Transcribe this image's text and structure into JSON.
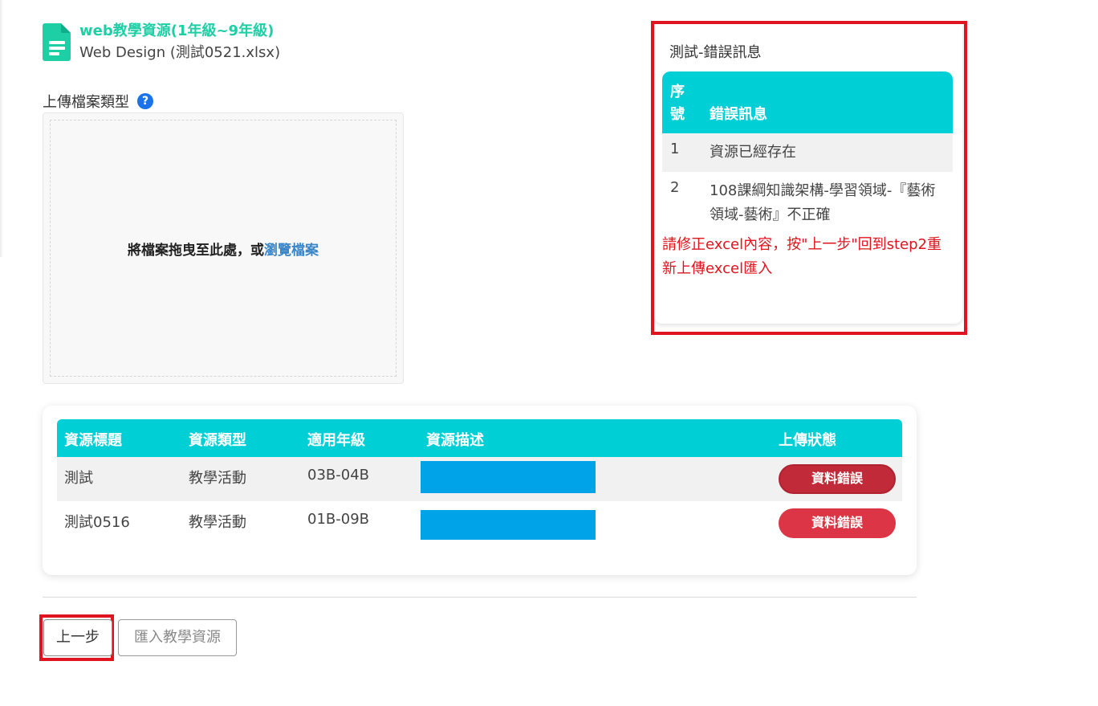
{
  "file": {
    "title": "web教學資源(1年級~9年級)",
    "subtitle": "Web Design (測試0521.xlsx)",
    "icon": "document-icon",
    "title_color": "#1ecfa6"
  },
  "upload": {
    "label": "上傳檔案類型",
    "help_icon": "question-circle-icon",
    "drop_text": "將檔案拖曳至此處，或",
    "browse_link": "瀏覽檔案"
  },
  "error_panel": {
    "title": "測試-錯誤訊息",
    "columns": [
      "序號",
      "錯誤訊息"
    ],
    "rows": [
      {
        "no": "1",
        "message": "資源已經存在"
      },
      {
        "no": "2",
        "message": "108課綱知識架構-學習領域-『藝術領域-藝術』不正確"
      }
    ],
    "note": "請修正excel內容，按\"上一步\"回到step2重新上傳excel匯入",
    "header_color": "#00cfd6",
    "note_color": "#e0141e"
  },
  "resources": {
    "columns": [
      "資源標題",
      "資源類型",
      "適用年級",
      "資源描述",
      "上傳狀態"
    ],
    "rows": [
      {
        "title": "測試",
        "type": "教學活動",
        "grade": "03B-04B",
        "status": "資料錯誤"
      },
      {
        "title": "測試0516",
        "type": "教學活動",
        "grade": "01B-09B",
        "status": "資料錯誤"
      }
    ],
    "header_color": "#00cfd6",
    "status_color": "#dc3545"
  },
  "buttons": {
    "prev": "上一步",
    "import": "匯入教學資源"
  }
}
